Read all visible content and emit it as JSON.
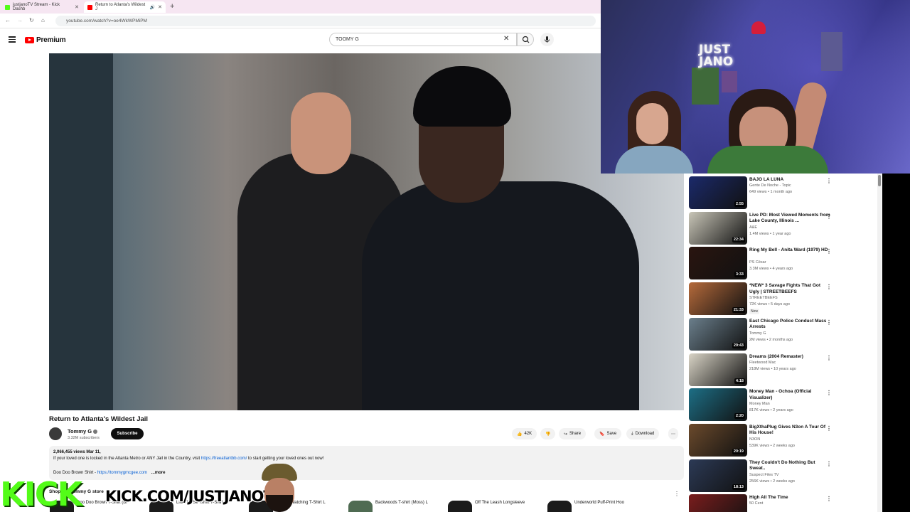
{
  "browser": {
    "tabs": [
      {
        "label": "justjanoTV Stream - Kick Dashb",
        "active": false
      },
      {
        "label": "Return to Atlanta's Wildest J",
        "active": true
      }
    ],
    "url": "youtube.com/watch?v=oe4WkWPMiPM"
  },
  "youtube": {
    "logo_text": "Premium",
    "search_value": "TOOMY G"
  },
  "video": {
    "title": "Return to Atlanta's Wildest Jail",
    "channel": "Tommy G",
    "subscribers": "3.32M subscribers",
    "subscribe_label": "Subscribe",
    "likes": "42K",
    "share_label": "Share",
    "save_label": "Save",
    "download_label": "Download",
    "views_date": "2,066,455 views  Mar 11,",
    "description_line1_pre": "If your loved one is locked in the Atlanta Metro or ANY Jail in the Country, visit ",
    "description_link1": "https://freeatlantbb.com/",
    "description_line1_post": " to start getting your loved ones out now!",
    "description_line2_pre": "Doo Doo Brown Shirt - ",
    "description_link2": "https://tommygmcgee.com",
    "more_label": "...more"
  },
  "store": {
    "title": "Shop the Tommy G store",
    "items": [
      {
        "name": "Doo Doo Brown T-Shirt (Bl"
      },
      {
        "name": "Liftt The Se Tshirt T-Shirt"
      },
      {
        "name": "Always Watching T-Shirt L"
      },
      {
        "name": "Backwoods T-shirt (Moss) L"
      },
      {
        "name": "Off The Leash Longsleeve"
      },
      {
        "name": "Underworld Puff-Print Hoo"
      }
    ]
  },
  "recommendations": [
    {
      "title": "BAJO LA LUNA",
      "channel": "Gente De Noche - Topic",
      "meta": "649 views • 1 month ago",
      "duration": "2:55",
      "color": "#1b2a6b",
      "new": ""
    },
    {
      "title": "Live PD: Most Viewed Moments from Lake County, Illinois ...",
      "channel": "A&E",
      "meta": "1.4M views • 1 year ago",
      "duration": "22:34",
      "color": "#c9c6b8",
      "new": ""
    },
    {
      "title": "Ring My Bell - Anita Ward (1979) HD",
      "channel": "PS César",
      "meta": "3.3M views • 4 years ago",
      "duration": "3:33",
      "color": "#2a1510",
      "new": ""
    },
    {
      "title": "*NEW* 3 Savage Fights That Got Ugly | STREETBEEFS",
      "channel": "STREETBEEFS",
      "meta": "72K views • 5 days ago",
      "duration": "21:33",
      "color": "#b56a3b",
      "new": "New"
    },
    {
      "title": "East Chicago Police Conduct Mass Arrests",
      "channel": "Tommy G",
      "meta": "2M views • 2 months ago",
      "duration": "29:43",
      "color": "#6b7f8c",
      "new": ""
    },
    {
      "title": "Dreams (2004 Remaster)",
      "channel": "Fleetwood Mac",
      "meta": "218M views • 10 years ago",
      "duration": "4:18",
      "color": "#d9d4c6",
      "new": ""
    },
    {
      "title": "Money Man - Ochoa (Official Visualizer)",
      "channel": "Money Man",
      "meta": "817K views • 2 years ago",
      "duration": "2:20",
      "color": "#1d6f86",
      "new": ""
    },
    {
      "title": "BigXthaPlug Gives N3on A Tour Of His House!",
      "channel": "N3ON",
      "meta": "539K views • 2 weeks ago",
      "duration": "20:19",
      "color": "#6b4a2c",
      "new": ""
    },
    {
      "title": "They Couldn't Do Nothing But Sweat..",
      "channel": "Suspect Files TV",
      "meta": "256K views • 2 weeks ago",
      "duration": "18:13",
      "color": "#2c3a56",
      "new": ""
    },
    {
      "title": "High All The Time",
      "channel": "50 Cent",
      "meta": "",
      "duration": "",
      "color": "#7a1d1d",
      "new": ""
    }
  ],
  "overlay": {
    "kick_logo": "KICK",
    "kick_url": "KICK.COM/JUSTJANOTV",
    "neon_text": "JUST\nJANO"
  }
}
